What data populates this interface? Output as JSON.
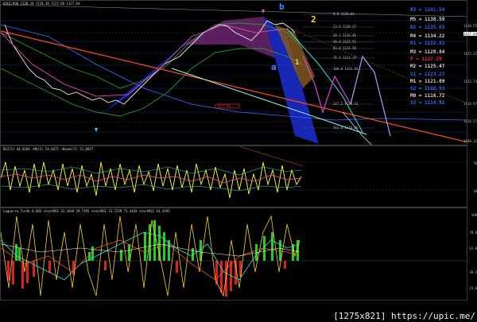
{
  "main": {
    "header": "GOLD,M30  1128.14 1128.38 1127.66 1127.64",
    "wave_labels": {
      "b": "b",
      "two": "2",
      "a": "a",
      "one": "1"
    },
    "levels": [
      {
        "label": "R3 = 1141.54",
        "color": "#2f6cff"
      },
      {
        "label": "M5 = 1138.59",
        "color": "#d9d9d9"
      },
      {
        "label": "R2 = 1135.63",
        "color": "#2f6cff"
      },
      {
        "label": "M4 = 1134.22",
        "color": "#d9d9d9"
      },
      {
        "label": "R1 = 1132.82",
        "color": "#2f6cff"
      },
      {
        "label": "M3 = 1129.84",
        "color": "#d9d9d9"
      },
      {
        "label": "P = 1127.29",
        "color": "#ff2a2a"
      },
      {
        "label": "M2 = 1125.47",
        "color": "#d9d9d9"
      },
      {
        "label": "S1 = 1123.27",
        "color": "#2f6cff"
      },
      {
        "label": "M1 = 1121.09",
        "color": "#d9d9d9"
      },
      {
        "label": "S2 = 1118.53",
        "color": "#2f6cff"
      },
      {
        "label": "M0 = 1116.72",
        "color": "#d9d9d9"
      },
      {
        "label": "S3 = 1114.92",
        "color": "#2f6cff"
      }
    ],
    "fib_labels": [
      "0.0 1128.84",
      "23.6 1128.37",
      "38.2 1126.46",
      "50.0 1125.55",
      "61.8 1124.50",
      "76.4 1123.19",
      "100.0 1121.43",
      "127.2 1120.41",
      "161.8 1116.66"
    ],
    "box_label": "1117.60",
    "price_ticks": [
      "1130.55",
      "1127.64",
      "1125.22",
      "1122.73",
      "1118.97",
      "1116.57",
      "1108.12"
    ]
  },
  "rsi": {
    "header": "RSI(5) 44.8264  ~MA(5) 54.0475  ~Bands(5) 51.8927",
    "ticks": [
      "70",
      "30"
    ]
  },
  "stoch": {
    "header": "Laguerre_Tur4b  0.803  stochRSI 33.3448 59.7395  stochRSI 51.7259 71.4434  stochRSI 61.3393",
    "ticks": [
      "100",
      "78.6",
      "61.8",
      "38.2",
      "23.6"
    ]
  },
  "footer": "[1275x821] https://upic.me/"
}
